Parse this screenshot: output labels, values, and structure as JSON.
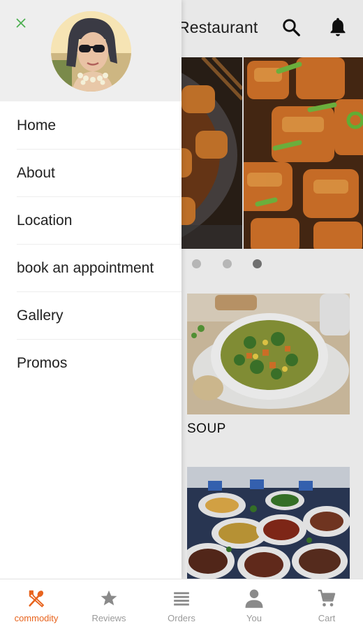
{
  "header": {
    "title": "Restaurant"
  },
  "drawer": {
    "menu": [
      {
        "label": "Home"
      },
      {
        "label": "About"
      },
      {
        "label": "Location"
      },
      {
        "label": "book an appointment"
      },
      {
        "label": "Gallery"
      },
      {
        "label": "Promos"
      }
    ]
  },
  "carousel": {
    "slide_count": 3,
    "active_index": 2
  },
  "cards": [
    {
      "label": "SOUP"
    },
    {
      "label": ""
    }
  ],
  "bottom_nav": [
    {
      "label": "commodity",
      "icon": "fork-spoon-icon",
      "active": true
    },
    {
      "label": "Reviews",
      "icon": "star-icon",
      "active": false
    },
    {
      "label": "Orders",
      "icon": "list-icon",
      "active": false
    },
    {
      "label": "You",
      "icon": "person-icon",
      "active": false
    },
    {
      "label": "Cart",
      "icon": "cart-icon",
      "active": false
    }
  ],
  "colors": {
    "accent": "#e8641e",
    "inactive": "#9a9a9a",
    "close": "#4caf50"
  }
}
